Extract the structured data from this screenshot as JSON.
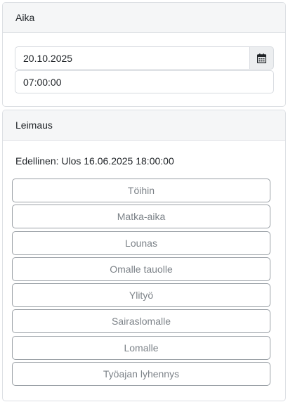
{
  "aika": {
    "header": "Aika",
    "date_value": "20.10.2025",
    "time_value": "07:00:00",
    "calendar_icon": "calendar-icon"
  },
  "leimaus": {
    "header": "Leimaus",
    "previous": "Edellinen: Ulos 16.06.2025 18:00:00",
    "buttons": [
      "Töihin",
      "Matka-aika",
      "Lounas",
      "Omalle tauolle",
      "Ylityö",
      "Sairaslomalle",
      "Lomalle",
      "Työajan lyhennys"
    ]
  }
}
